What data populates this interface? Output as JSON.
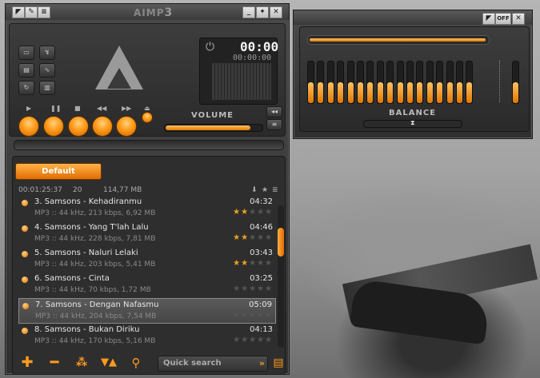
{
  "app": {
    "title": "AIMP",
    "version": "3"
  },
  "player": {
    "time_main": "00:00",
    "time_sub": "00:00:00",
    "volume_label": "VOLUME",
    "volume_level": 0.88,
    "buttons": [
      "play",
      "pause",
      "stop",
      "previous",
      "next",
      "open"
    ]
  },
  "equalizer": {
    "off_label": "OFF",
    "balance_label": "BALANCE",
    "band_count": 18
  },
  "playlist": {
    "tab_label": "Default",
    "total_time": "00:01:25:37",
    "track_count": "20",
    "total_size": "114,77 MB",
    "tracks": [
      {
        "title": "3. Samsons - Kehadiranmu",
        "duration": "04:32",
        "info": "MP3 :: 44 kHz, 213 kbps, 6,92 MB",
        "rating": 2
      },
      {
        "title": "4. Samsons - Yang T'lah Lalu",
        "duration": "04:46",
        "info": "MP3 :: 44 kHz, 228 kbps, 7,81 MB",
        "rating": 2
      },
      {
        "title": "5. Samsons - Naluri Lelaki",
        "duration": "03:43",
        "info": "MP3 :: 44 kHz, 203 kbps, 5,41 MB",
        "rating": 2
      },
      {
        "title": "6. Samsons - Cinta",
        "duration": "03:25",
        "info": "MP3 :: 44 kHz, 70 kbps, 1,72 MB",
        "rating": 0
      },
      {
        "title": "7. Samsons - Dengan Nafasmu",
        "duration": "05:09",
        "info": "MP3 :: 44 kHz, 204 kbps, 7,54 MB",
        "rating": 0,
        "selected": true
      },
      {
        "title": "8. Samsons - Bukan Diriku",
        "duration": "04:13",
        "info": "MP3 :: 44 kHz, 170 kbps, 5,16 MB",
        "rating": 0
      }
    ]
  },
  "search": {
    "placeholder": "Quick search"
  },
  "colors": {
    "accent": "#ff9a1a",
    "panel": "#2e2e2e"
  }
}
